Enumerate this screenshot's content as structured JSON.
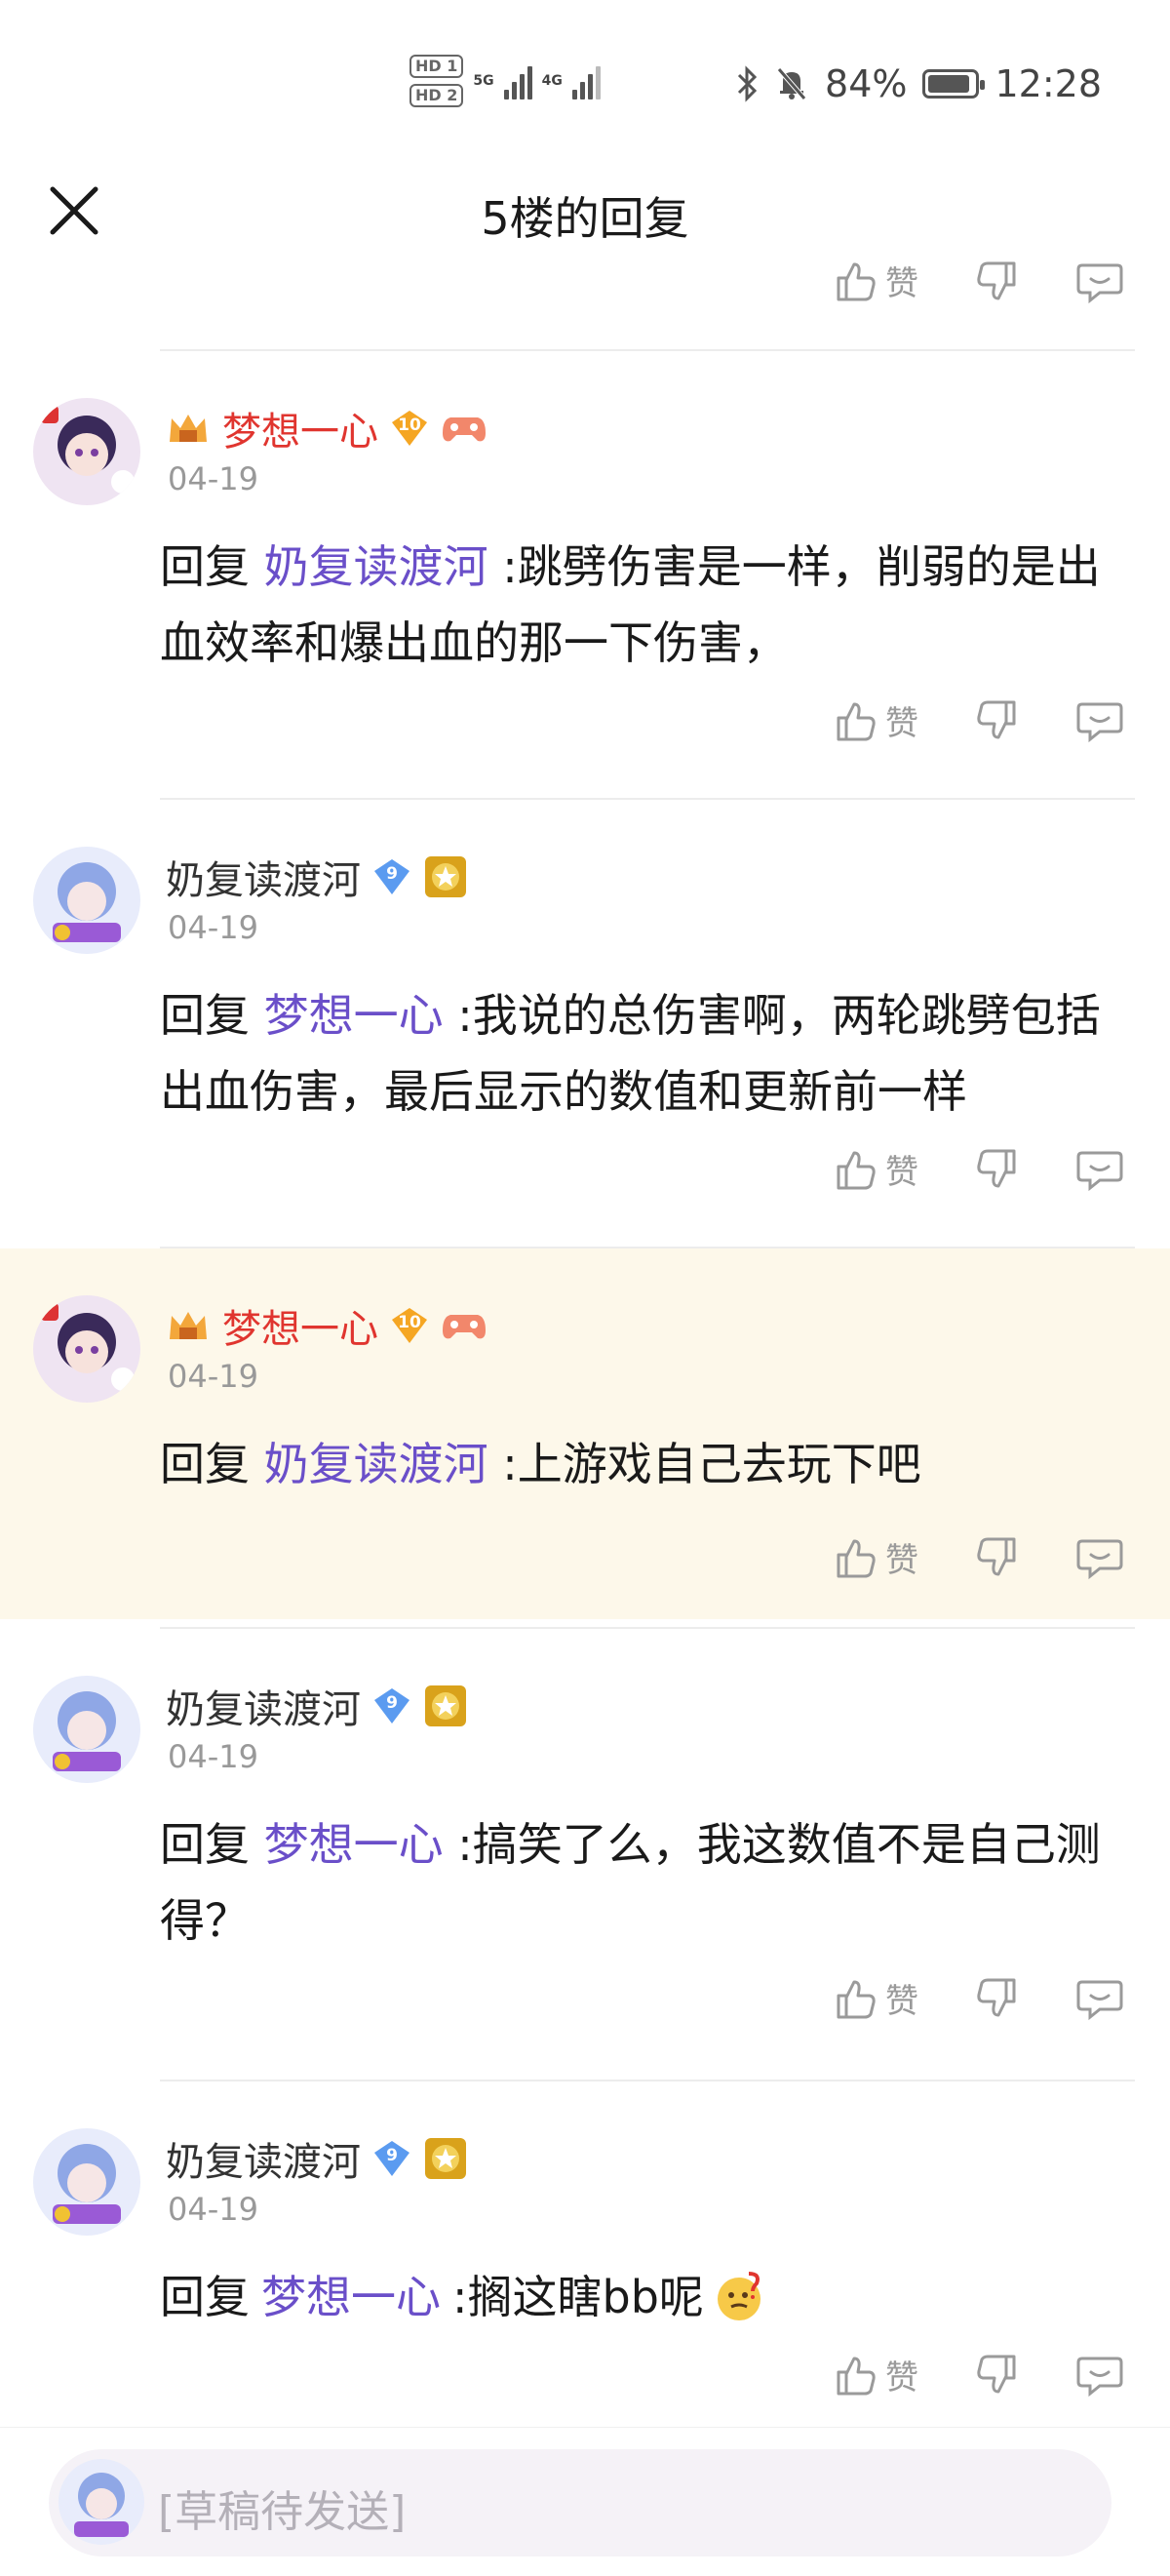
{
  "status_bar": {
    "hd1": "HD 1",
    "hd2": "HD 2",
    "net1": "5G",
    "net2": "4G",
    "battery": "84%",
    "time": "12:28"
  },
  "header": {
    "title": "5楼的回复"
  },
  "top_partial": {
    "like_label": "赞"
  },
  "replies": [
    {
      "user": "梦想一心",
      "level": "10",
      "date": "04-19",
      "prefix": "回复",
      "mention": "奶复读渡河",
      "text": ":跳劈伤害是一样，削弱的是出血效率和爆出血的那一下伤害，",
      "like_label": "赞"
    },
    {
      "user": "奶复读渡河",
      "level": "9",
      "date": "04-19",
      "prefix": "回复",
      "mention": "梦想一心",
      "text": ":我说的总伤害啊，两轮跳劈包括出血伤害，最后显示的数值和更新前一样",
      "like_label": "赞"
    },
    {
      "user": "梦想一心",
      "level": "10",
      "date": "04-19",
      "prefix": "回复",
      "mention": "奶复读渡河",
      "text": ":上游戏自己去玩下吧",
      "like_label": "赞"
    },
    {
      "user": "奶复读渡河",
      "level": "9",
      "date": "04-19",
      "prefix": "回复",
      "mention": "梦想一心",
      "text": ":搞笑了么，我这数值不是自己测得？",
      "like_label": "赞"
    },
    {
      "user": "奶复读渡河",
      "level": "9",
      "date": "04-19",
      "prefix": "回复",
      "mention": "梦想一心",
      "text": ":搁这瞎bb呢",
      "like_label": "赞"
    }
  ],
  "composer": {
    "placeholder": "[草稿待发送]"
  }
}
